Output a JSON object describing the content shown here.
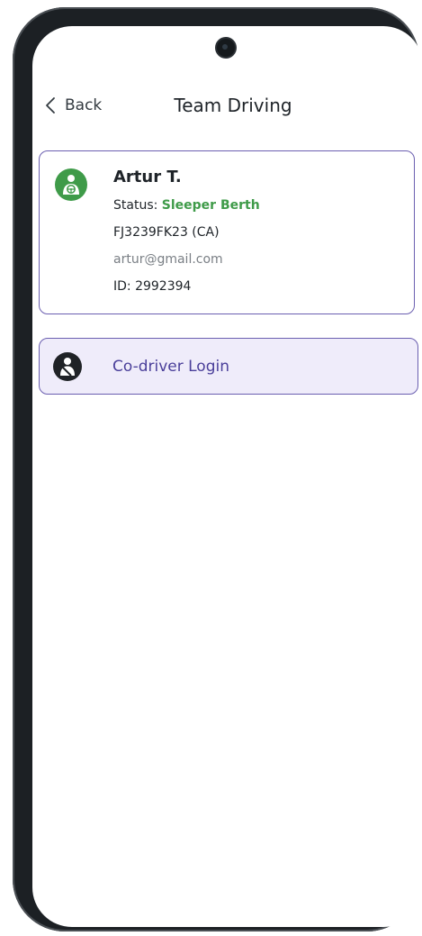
{
  "header": {
    "back_label": "Back",
    "title": "Team Driving"
  },
  "driver": {
    "name": "Artur T.",
    "status_label": "Status:",
    "status_value": "Sleeper Berth",
    "license": "FJ3239FK23 (CA)",
    "email": "artur@gmail.com",
    "id_text": "ID: 2992394",
    "avatar_icon": "driver-steering-icon"
  },
  "codriver": {
    "label": "Co-driver Login",
    "icon": "driver-seatbelt-icon"
  },
  "colors": {
    "accent": "#6b5fb0",
    "status_green": "#3f9b49",
    "codriver_bg": "#efecfa"
  }
}
